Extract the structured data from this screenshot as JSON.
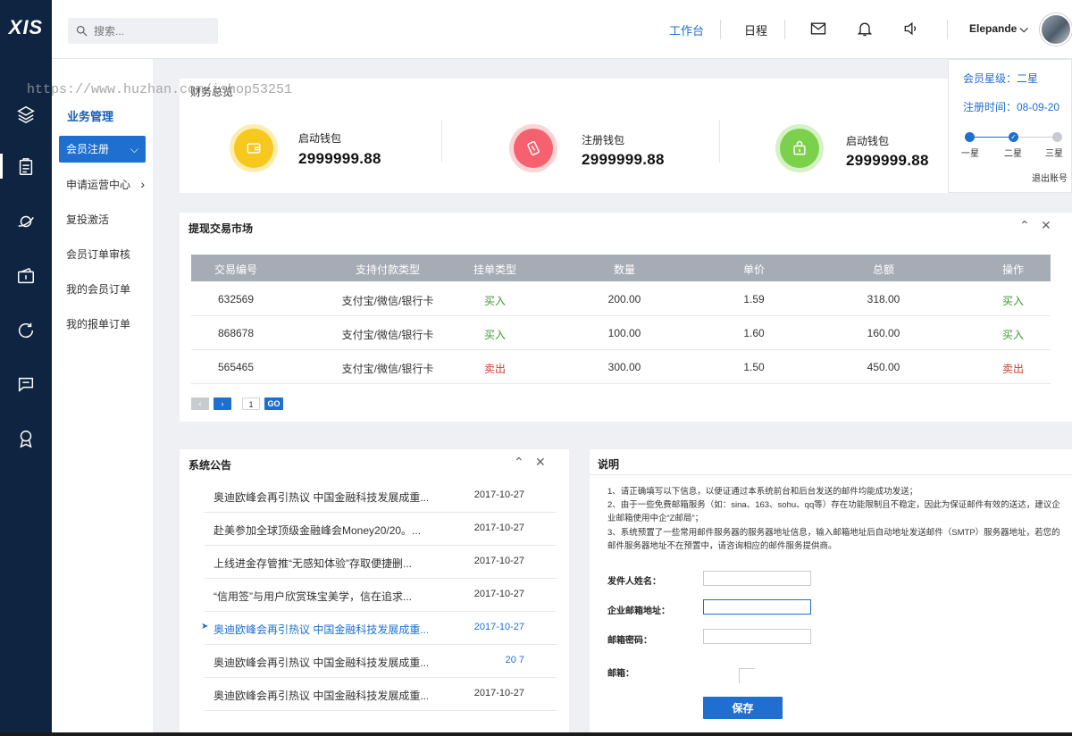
{
  "app": {
    "logo": "XIS"
  },
  "header": {
    "search_placeholder": "搜索...",
    "nav": [
      "工作台",
      "日程"
    ],
    "user_name": "Elepande ⌵",
    "icons": [
      "mail-icon",
      "bell-icon",
      "volume-icon"
    ]
  },
  "rail": {
    "icons": [
      "layers-icon",
      "clipboard-icon",
      "planet-icon",
      "wallet-icon",
      "refresh-icon",
      "chat-icon",
      "medal-icon"
    ]
  },
  "sidebar": {
    "title": "业务管理",
    "active": {
      "label": "会员注册",
      "chevron": "⌵"
    },
    "items": [
      {
        "label": "申请运营中心",
        "chevron": "›"
      },
      {
        "label": "复投激活"
      },
      {
        "label": "会员订单审核"
      },
      {
        "label": "我的会员订单"
      },
      {
        "label": "我的报单订单"
      }
    ]
  },
  "watermark": "https://www.huzhan.com/ishop53251",
  "wallet": {
    "title": "财务总览",
    "items": [
      {
        "label": "启动钱包",
        "value": "2999999.88",
        "color": "#f7c81d",
        "icon": "wallet-icon"
      },
      {
        "label": "注册钱包",
        "value": "2999999.88",
        "color": "#f5616e",
        "icon": "card-icon"
      },
      {
        "label": "启动钱包",
        "value": "2999999.88",
        "color": "#7bd14b",
        "icon": "bag-icon"
      }
    ]
  },
  "member": {
    "level": "会员星级：二星",
    "time": "注册时间：08-09-20",
    "steps": [
      "一星",
      "二星",
      "三星"
    ],
    "logout": "退出账号"
  },
  "trade": {
    "title": "提现交易市场",
    "columns": [
      "交易编号",
      "支持付款类型",
      "挂单类型",
      "数量",
      "单价",
      "总额",
      "操作"
    ],
    "rows": [
      {
        "id": "632569",
        "pay": "支付宝/微信/银行卡",
        "type": "买入",
        "qty": "200.00",
        "price": "1.59",
        "total": "318.00",
        "action": "买入",
        "kind": "buy"
      },
      {
        "id": "868678",
        "pay": "支付宝/微信/银行卡",
        "type": "买入",
        "qty": "100.00",
        "price": "1.60",
        "total": "160.00",
        "action": "买入",
        "kind": "buy"
      },
      {
        "id": "565465",
        "pay": "支付宝/微信/银行卡",
        "type": "卖出",
        "qty": "300.00",
        "price": "1.50",
        "total": "450.00",
        "action": "卖出",
        "kind": "sell"
      }
    ],
    "pager": {
      "prev": "‹",
      "next": "›",
      "page": "1",
      "go": "GO"
    }
  },
  "notice": {
    "title": "系统公告",
    "items": [
      {
        "text": "奥迪欧峰会再引热议 中国金融科技发展成重...",
        "date": "2017-10-27"
      },
      {
        "text": "赴美参加全球顶级金融峰会Money20/20。...",
        "date": "2017-10-27"
      },
      {
        "text": "上线进金存管推“无感知体验”存取便捷删...",
        "date": "2017-10-27"
      },
      {
        "text": "“信用签”与用户欣赏珠宝美学，信在追求...",
        "date": "2017-10-27"
      },
      {
        "text": "奥迪欧峰会再引热议 中国金融科技发展成重...",
        "date": "2017-10-27",
        "active": true
      },
      {
        "text": "奥迪欧峰会再引热议 中国金融科技发展成重...",
        "date": "20 7"
      },
      {
        "text": "奥迪欧峰会再引热议 中国金融科技发展成重...",
        "date": "2017-10-27"
      }
    ]
  },
  "explain": {
    "title": "说明",
    "paragraphs": [
      "1、请正确填写以下信息，以便证通过本系统前台和后台发送的邮件均能成功发送；",
      "2、由于一些免费邮箱服务（如：sina、163、sohu、qq等）存在功能限制且不稳定，因此为保证邮件有效的送达，建议企业邮箱使用中企“Z邮局”；",
      "3、系统预置了一些常用邮件服务器的服务器地址信息，输入邮箱地址后自动地址发送邮件（SMTP）服务器地址，若您的邮件服务器地址不在预置中，请咨询相应的邮件服务提供商。"
    ],
    "fields": [
      {
        "label": "发件人姓名："
      },
      {
        "label": "企业邮箱地址："
      },
      {
        "label": "邮箱密码："
      },
      {
        "label": "邮箱："
      }
    ],
    "save": "保存"
  }
}
